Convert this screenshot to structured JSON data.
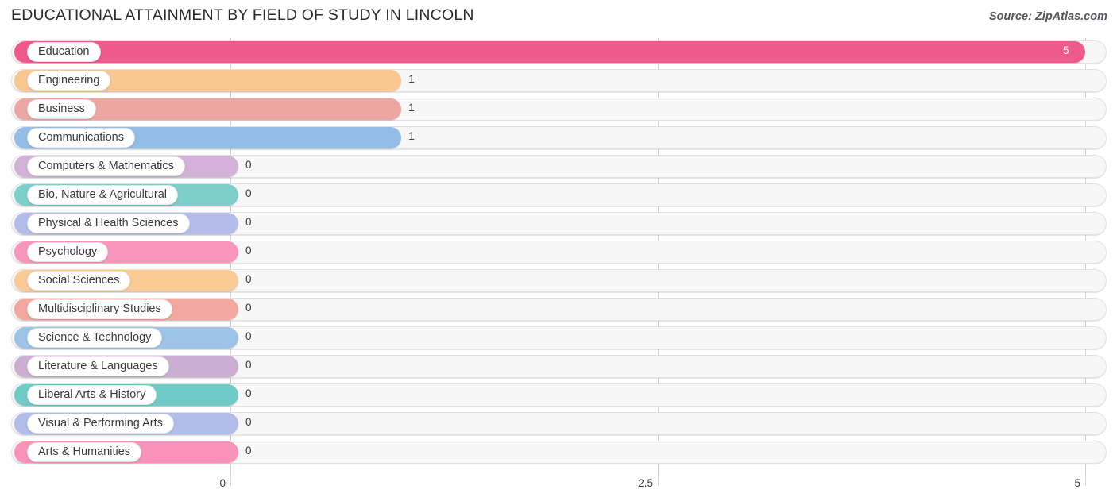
{
  "header": {
    "title": "EDUCATIONAL ATTAINMENT BY FIELD OF STUDY IN LINCOLN",
    "source": "Source: ZipAtlas.com"
  },
  "chart_data": {
    "type": "bar",
    "orientation": "horizontal",
    "title": "EDUCATIONAL ATTAINMENT BY FIELD OF STUDY IN LINCOLN",
    "xlabel": "",
    "ylabel": "",
    "xlim": [
      0,
      5
    ],
    "ticks": [
      "0",
      "2.5",
      "5"
    ],
    "tick_values": [
      0,
      2.5,
      5
    ],
    "grid": true,
    "legend": "none",
    "categories": [
      "Education",
      "Engineering",
      "Business",
      "Communications",
      "Computers & Mathematics",
      "Bio, Nature & Agricultural",
      "Physical & Health Sciences",
      "Psychology",
      "Social Sciences",
      "Multidisciplinary Studies",
      "Science & Technology",
      "Literature & Languages",
      "Liberal Arts & History",
      "Visual & Performing Arts",
      "Arts & Humanities"
    ],
    "values": [
      5,
      1,
      1,
      1,
      0,
      0,
      0,
      0,
      0,
      0,
      0,
      0,
      0,
      0,
      0
    ],
    "value_labels": [
      "5",
      "1",
      "1",
      "1",
      "0",
      "0",
      "0",
      "0",
      "0",
      "0",
      "0",
      "0",
      "0",
      "0",
      "0"
    ],
    "colors": [
      "#ee5a8c",
      "#f9c891",
      "#eda7a2",
      "#93bde6",
      "#d2b2d6",
      "#7ccfcb",
      "#b4bde9",
      "#f897bb",
      "#fbcb96",
      "#f2a79f",
      "#9ec3e9",
      "#ccaed3",
      "#70cbc7",
      "#b3bde9",
      "#f993b9"
    ]
  },
  "axis": {
    "tick_labels": [
      "0",
      "2.5",
      "5"
    ]
  }
}
